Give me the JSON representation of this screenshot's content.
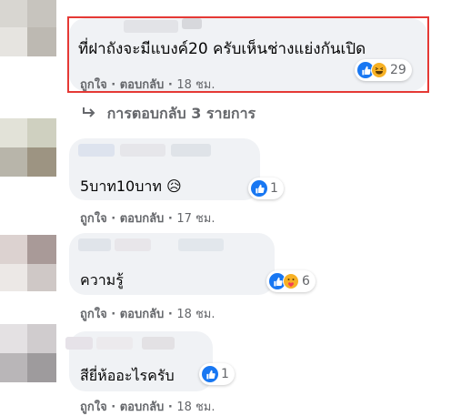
{
  "comments": [
    {
      "text": "ที่ฝาถังจะมีแบงค์20 ครับเห็นช่างแย่งกันเปิด",
      "like_label": "ถูกใจ",
      "reply_label": "ตอบกลับ",
      "time": "18 ชม.",
      "reaction_count": "29",
      "reactions": [
        "like-icon",
        "haha-icon"
      ],
      "highlighted": true
    },
    {
      "text": "5บาท10บาท 😥",
      "like_label": "ถูกใจ",
      "reply_label": "ตอบกลับ",
      "time": "17 ชม.",
      "reaction_count": "1",
      "reactions": [
        "like-icon"
      ]
    },
    {
      "text": "ความรู้",
      "like_label": "ถูกใจ",
      "reply_label": "ตอบกลับ",
      "time": "18 ชม.",
      "reaction_count": "6",
      "reactions": [
        "like-icon",
        "care-icon"
      ]
    },
    {
      "text": "สียี่ห้ออะไรครับ",
      "like_label": "ถูกใจ",
      "reply_label": "ตอบกลับ",
      "time": "18 ชม.",
      "reaction_count": "1",
      "reactions": [
        "like-icon"
      ]
    }
  ],
  "replies_link": {
    "text": "การตอบกลับ 3 รายการ",
    "icon": "reply-arrow-icon"
  },
  "colors": {
    "like_blue": "#1877f2",
    "bubble_bg": "#f0f2f5",
    "meta_gray": "#65676b",
    "highlight_red": "#e53935"
  }
}
